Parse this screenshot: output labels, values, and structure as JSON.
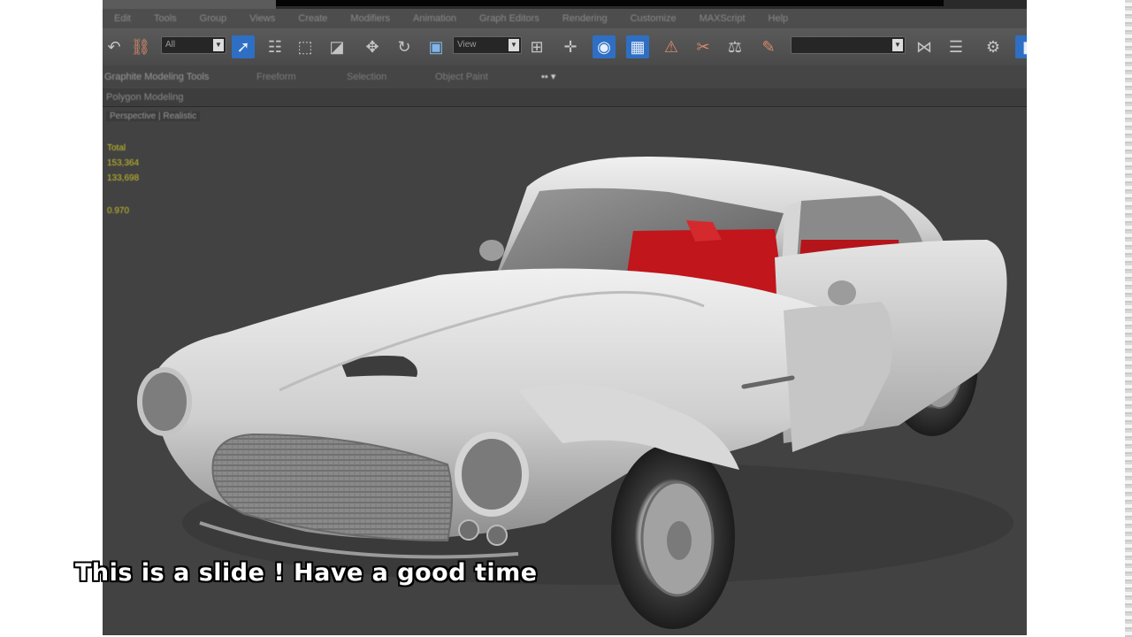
{
  "app": {
    "menu": [
      "Edit",
      "Tools",
      "Group",
      "Views",
      "Create",
      "Modifiers",
      "Animation",
      "Graph Editors",
      "Rendering",
      "Customize",
      "MAXScript",
      "Help"
    ],
    "selection_filter": "All",
    "reference_coord": "View",
    "ribbon_tabs": [
      "Graphite Modeling Tools",
      "Freeform",
      "Selection",
      "Object Paint"
    ],
    "subribbon": "Polygon Modeling",
    "viewport_label": "Perspective | Realistic",
    "stats": {
      "label": "Total",
      "line1": "153,364",
      "line2": "133,698",
      "fps": "0.970"
    }
  },
  "toolbar_icons": [
    "undo-icon",
    "link-icon",
    "select-icon",
    "select-by-name-icon",
    "rect-select-icon",
    "window-crossing-icon",
    "move-icon",
    "rotate-icon",
    "scale-icon",
    "snap-icon",
    "mirror-icon",
    "align-icon",
    "render-setup-icon",
    "render-icon"
  ],
  "colors": {
    "viewport_bg": "#424242",
    "car_body": "#d7d7d7",
    "interior": "#c0161c",
    "accent_blue": "#2e6fc3"
  },
  "caption": "This is a slide ! Have a good time"
}
